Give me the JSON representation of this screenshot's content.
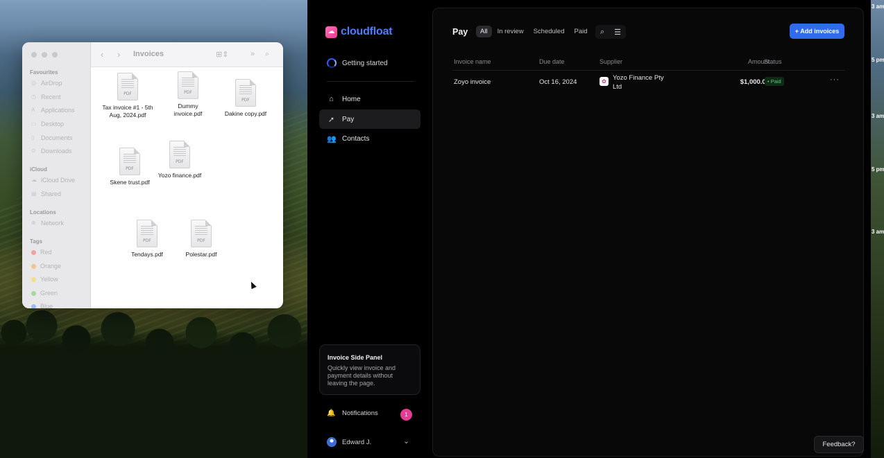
{
  "desktop": {
    "edge_times": [
      "3 am",
      "5 pm",
      "3 am",
      "5 pm",
      "3 am"
    ]
  },
  "finder": {
    "title": "Invoices",
    "sidebar": {
      "favourites_label": "Favourites",
      "favourites": [
        "AirDrop",
        "Recent",
        "Applications",
        "Desktop",
        "Documents",
        "Downloads"
      ],
      "icloud_label": "iCloud",
      "icloud": [
        "iCloud Drive",
        "Shared"
      ],
      "locations_label": "Locations",
      "locations": [
        "Network"
      ],
      "tags_label": "Tags",
      "tags": [
        {
          "label": "Red",
          "color": "#f2a0a0"
        },
        {
          "label": "Orange",
          "color": "#f4c48c"
        },
        {
          "label": "Yellow",
          "color": "#f0e08a"
        },
        {
          "label": "Green",
          "color": "#a6d8a0"
        },
        {
          "label": "Blue",
          "color": "#9cbcf0"
        }
      ]
    },
    "files": [
      {
        "name": "Tax invoice #1 - 5th Aug, 2024.pdf",
        "type": "PDF"
      },
      {
        "name": "Dummy invoice.pdf",
        "type": "PDF"
      },
      {
        "name": "Dakine copy.pdf",
        "type": "PDF"
      },
      {
        "name": "Skene trust.pdf",
        "type": "PDF"
      },
      {
        "name": "Yozo finance.pdf",
        "type": "PDF"
      },
      {
        "name": "Tendays.pdf",
        "type": "PDF"
      },
      {
        "name": "Polestar.pdf",
        "type": "PDF"
      }
    ]
  },
  "app": {
    "brand": "cloudfloat",
    "brand_color": "#4f7dff",
    "getting_started": "Getting started",
    "nav": [
      {
        "label": "Home",
        "icon": "home-icon"
      },
      {
        "label": "Pay",
        "icon": "pay-icon",
        "active": true
      },
      {
        "label": "Contacts",
        "icon": "contacts-icon"
      }
    ],
    "side_panel": {
      "title": "Invoice Side Panel",
      "description": "Quickly view invoice and payment details without leaving the page."
    },
    "notifications": {
      "label": "Notifications",
      "count": "1"
    },
    "user": {
      "name": "Edward J."
    },
    "pay": {
      "title": "Pay",
      "filters": [
        "All",
        "In review",
        "Scheduled",
        "Paid"
      ],
      "active_filter": "All",
      "add_button": "+ Add invoices",
      "columns": [
        "Invoice name",
        "Due date",
        "Supplier",
        "Amount",
        "Status"
      ],
      "rows": [
        {
          "invoice_name": "Zoyo invoice",
          "due_date": "Oct 16, 2024",
          "supplier": "Yozo Finance Pty Ltd",
          "amount": "$1,000.00",
          "status": "• Paid"
        }
      ]
    },
    "feedback": "Feedback?"
  }
}
